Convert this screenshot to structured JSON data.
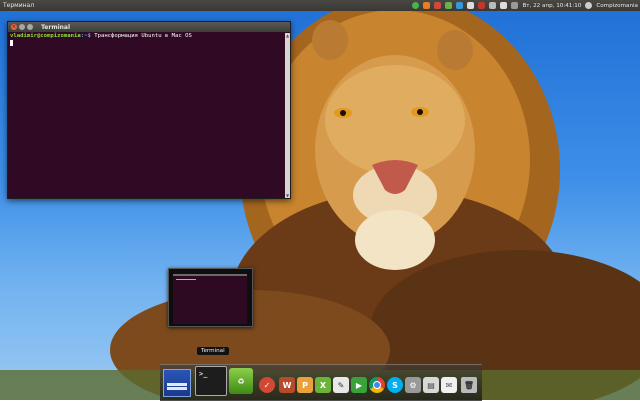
{
  "top_panel": {
    "app_title": "Терминал",
    "clock": "Вт, 22 апр, 10:41:10",
    "user": "Compizomania"
  },
  "terminal": {
    "title": "Terminal",
    "prompt_user": "vladimir@compizomania",
    "prompt_path": ":~$",
    "command": " Трансформация Ubuntu в Mac OS"
  },
  "dock": {
    "tooltip": "Terminal",
    "items": [
      "workspaces-icon",
      "terminal-icon",
      "trash-recycle-icon",
      "ubuntu-settings-icon",
      "wine-icon",
      "installer-icon",
      "xchat-icon",
      "text-editor-icon",
      "player-icon",
      "chrome-icon",
      "skype-icon",
      "settings-icon",
      "archive-icon",
      "mail-icon",
      "trash-icon"
    ]
  },
  "colors": {
    "terminal_bg": "#300a24",
    "prompt_user": "#8ae234",
    "prompt_path": "#729fcf",
    "panel_bg": "#3c3b37",
    "close_button": "#ee6436"
  }
}
